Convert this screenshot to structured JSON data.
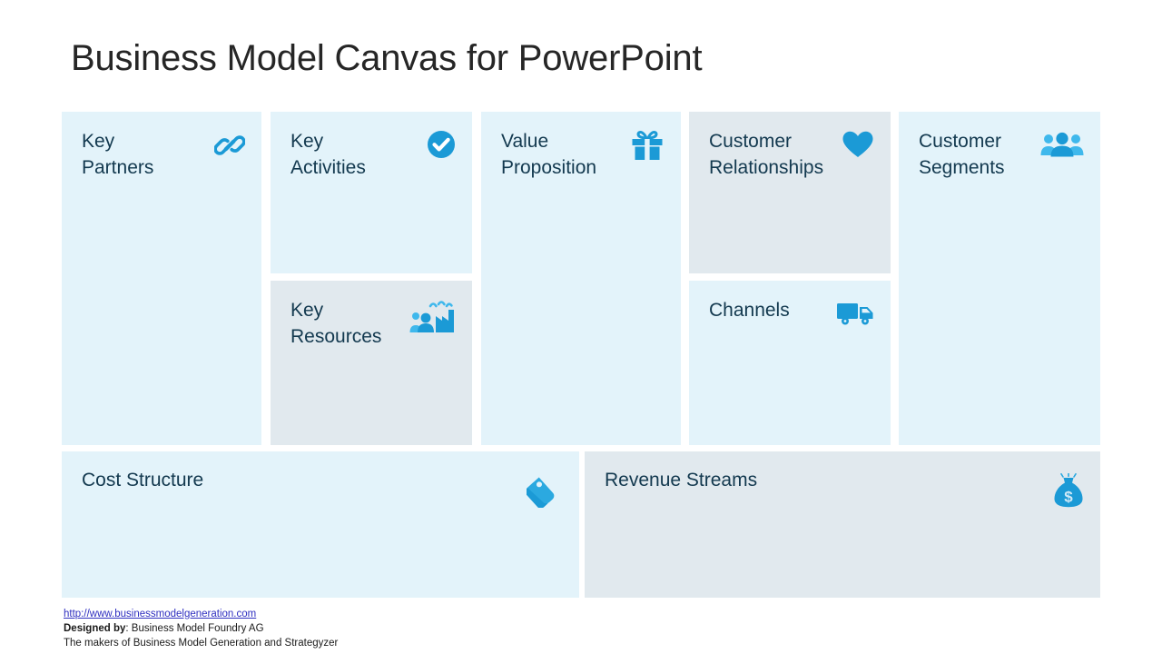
{
  "page": {
    "title": "Business Model Canvas for PowerPoint",
    "accent_color": "#1b9ad6",
    "text_color": "#13394f",
    "title_color": "#262626",
    "shade_light": "#e3f3fa",
    "shade_gray": "#e1e9ee"
  },
  "blocks": [
    {
      "key": "key_partners",
      "label": "Key\nPartners",
      "icon": "chain-link-icon",
      "shade": "light"
    },
    {
      "key": "key_activities",
      "label": "Key\nActivities",
      "icon": "check-circle-icon",
      "shade": "light"
    },
    {
      "key": "key_resources",
      "label": "Key\nResources",
      "icon": "factory-people-icon",
      "shade": "gray"
    },
    {
      "key": "value_proposition",
      "label": "Value\nProposition",
      "icon": "gift-box-icon",
      "shade": "light"
    },
    {
      "key": "customer_relationships",
      "label": "Customer\nRelationships",
      "icon": "heart-icon",
      "shade": "gray"
    },
    {
      "key": "channels",
      "label": "Channels",
      "icon": "delivery-truck-icon",
      "shade": "light"
    },
    {
      "key": "customer_segments",
      "label": "Customer\nSegments",
      "icon": "people-group-icon",
      "shade": "light"
    },
    {
      "key": "cost_structure",
      "label": "Cost Structure",
      "icon": "price-tags-icon",
      "shade": "light"
    },
    {
      "key": "revenue_streams",
      "label": "Revenue Streams",
      "icon": "money-bag-icon",
      "shade": "gray"
    }
  ],
  "footer": {
    "url": "http://www.businessmodelgeneration.com",
    "designed_by_label": "Designed by",
    "designed_by_value": ": Business Model Foundry AG",
    "tagline": "The makers of Business Model Generation and Strategyzer"
  }
}
